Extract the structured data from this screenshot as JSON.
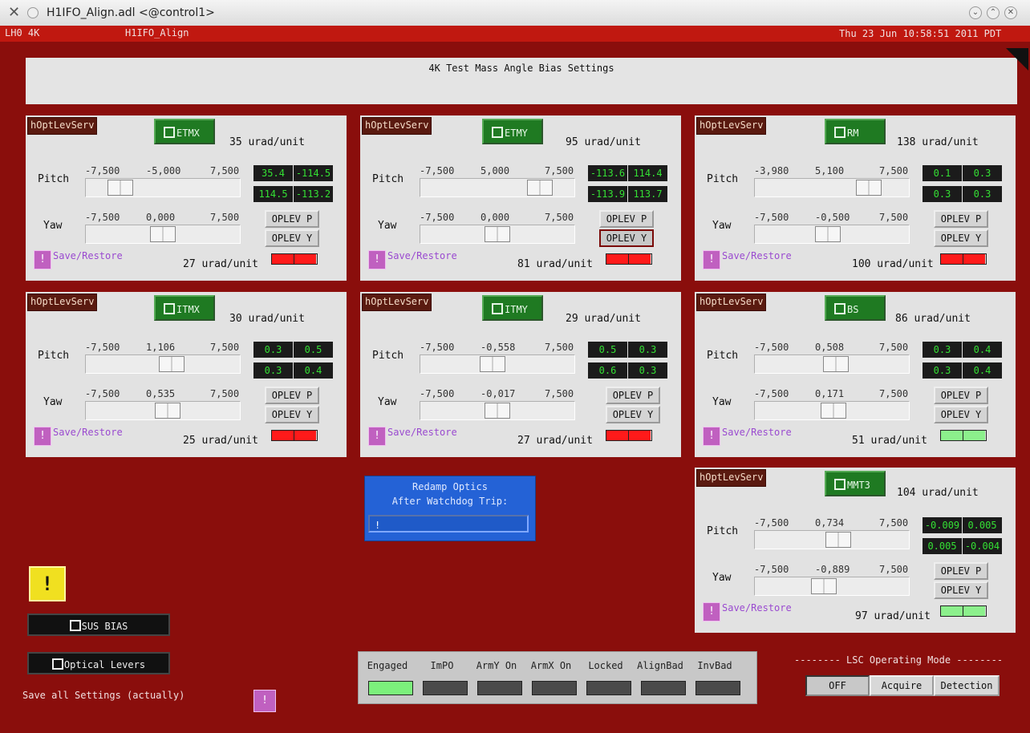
{
  "window": {
    "title": "H1IFO_Align.adl <@control1>"
  },
  "header": {
    "site": "LH0 4K",
    "screen": "H1IFO_Align",
    "datetime": "Thu 23 Jun 10:58:51 2011 PDT"
  },
  "banner": {
    "title": "4K Test Mass Angle Bias Settings"
  },
  "labels": {
    "pitch": "Pitch",
    "yaw": "Yaw",
    "oplev_p": "OPLEV P",
    "oplev_y": "OPLEV Y",
    "save_restore": "Save/Restore",
    "opt_lev_serv": "hOptLevServ",
    "excl": "!"
  },
  "panels": [
    {
      "name": "ETMX",
      "top_unit": "35 urad/unit",
      "bottom_unit": "27 urad/unit",
      "pitch": {
        "min": "-7,500",
        "val": "-5,000",
        "max": "7,500",
        "frac": 0.17
      },
      "yaw": {
        "min": "-7,500",
        "val": "0,000",
        "max": "7,500",
        "frac": 0.5
      },
      "readbacks": [
        "35.4",
        "-114.5",
        "114.5",
        "-113.2"
      ],
      "status": [
        "#ff1a1a",
        "#ff1a1a"
      ]
    },
    {
      "name": "ETMY",
      "top_unit": "95 urad/unit",
      "bottom_unit": "81 urad/unit",
      "pitch": {
        "min": "-7,500",
        "val": "5,000",
        "max": "7,500",
        "frac": 0.83
      },
      "yaw": {
        "min": "-7,500",
        "val": "0,000",
        "max": "7,500",
        "frac": 0.5
      },
      "readbacks": [
        "-113.6",
        "114.4",
        "-113.9",
        "113.7"
      ],
      "status": [
        "#ff1a1a",
        "#ff1a1a"
      ]
    },
    {
      "name": "RM",
      "top_unit": "138 urad/unit",
      "bottom_unit": "100 urad/unit",
      "pitch": {
        "min": "-3,980",
        "val": "5,100",
        "max": "7,500",
        "frac": 0.79
      },
      "yaw": {
        "min": "-7,500",
        "val": "-0,500",
        "max": "7,500",
        "frac": 0.47
      },
      "readbacks": [
        "0.1",
        "0.3",
        "0.3",
        "0.3"
      ],
      "status": [
        "#ff1a1a",
        "#ff1a1a"
      ]
    },
    {
      "name": "ITMX",
      "top_unit": "30 urad/unit",
      "bottom_unit": "25 urad/unit",
      "pitch": {
        "min": "-7,500",
        "val": "1,106",
        "max": "7,500",
        "frac": 0.57
      },
      "yaw": {
        "min": "-7,500",
        "val": "0,535",
        "max": "7,500",
        "frac": 0.54
      },
      "readbacks": [
        "0.3",
        "0.5",
        "0.3",
        "0.4"
      ],
      "status": [
        "#ff1a1a",
        "#ff1a1a"
      ]
    },
    {
      "name": "ITMY",
      "top_unit": "29 urad/unit",
      "bottom_unit": "27 urad/unit",
      "pitch": {
        "min": "-7,500",
        "val": "-0,558",
        "max": "7,500",
        "frac": 0.46
      },
      "yaw": {
        "min": "-7,500",
        "val": "-0,017",
        "max": "7,500",
        "frac": 0.5
      },
      "readbacks": [
        "0.5",
        "0.3",
        "0.6",
        "0.3"
      ],
      "status": [
        "#ff1a1a",
        "#ff1a1a"
      ]
    },
    {
      "name": "BS",
      "top_unit": "86 urad/unit",
      "bottom_unit": "51 urad/unit",
      "pitch": {
        "min": "-7,500",
        "val": "0,508",
        "max": "7,500",
        "frac": 0.53
      },
      "yaw": {
        "min": "-7,500",
        "val": "0,171",
        "max": "7,500",
        "frac": 0.51
      },
      "readbacks": [
        "0.3",
        "0.4",
        "0.3",
        "0.4"
      ],
      "status": [
        "#8cf08c",
        "#8cf08c"
      ]
    },
    {
      "name": "MMT3",
      "top_unit": "104 urad/unit",
      "bottom_unit": "97 urad/unit",
      "pitch": {
        "min": "-7,500",
        "val": "0,734",
        "max": "7,500",
        "frac": 0.55
      },
      "yaw": {
        "min": "-7,500",
        "val": "-0,889",
        "max": "7,500",
        "frac": 0.44
      },
      "readbacks": [
        "-0.009",
        "0.005",
        "0.005",
        "-0.004"
      ],
      "status": [
        "#8cf08c",
        "#8cf08c"
      ]
    }
  ],
  "redamp": {
    "line1": "Redamp Optics",
    "line2": "After Watchdog Trip:",
    "button": "!"
  },
  "sus_bias": "SUS BIAS",
  "optical_levers": "Optical Levers",
  "save_all": "Save all Settings (actually)",
  "flags": [
    {
      "label": "Engaged",
      "color": "#7cf07c"
    },
    {
      "label": "ImPO",
      "color": "#4a4a4a"
    },
    {
      "label": "ArmY On",
      "color": "#4a4a4a"
    },
    {
      "label": "ArmX On",
      "color": "#4a4a4a"
    },
    {
      "label": "Locked",
      "color": "#4a4a4a"
    },
    {
      "label": "AlignBad",
      "color": "#4a4a4a"
    },
    {
      "label": "InvBad",
      "color": "#4a4a4a"
    }
  ],
  "lsc": {
    "title": "-------- LSC Operating Mode --------",
    "modes": [
      "OFF",
      "Acquire",
      "Detection"
    ],
    "selected": "OFF"
  }
}
